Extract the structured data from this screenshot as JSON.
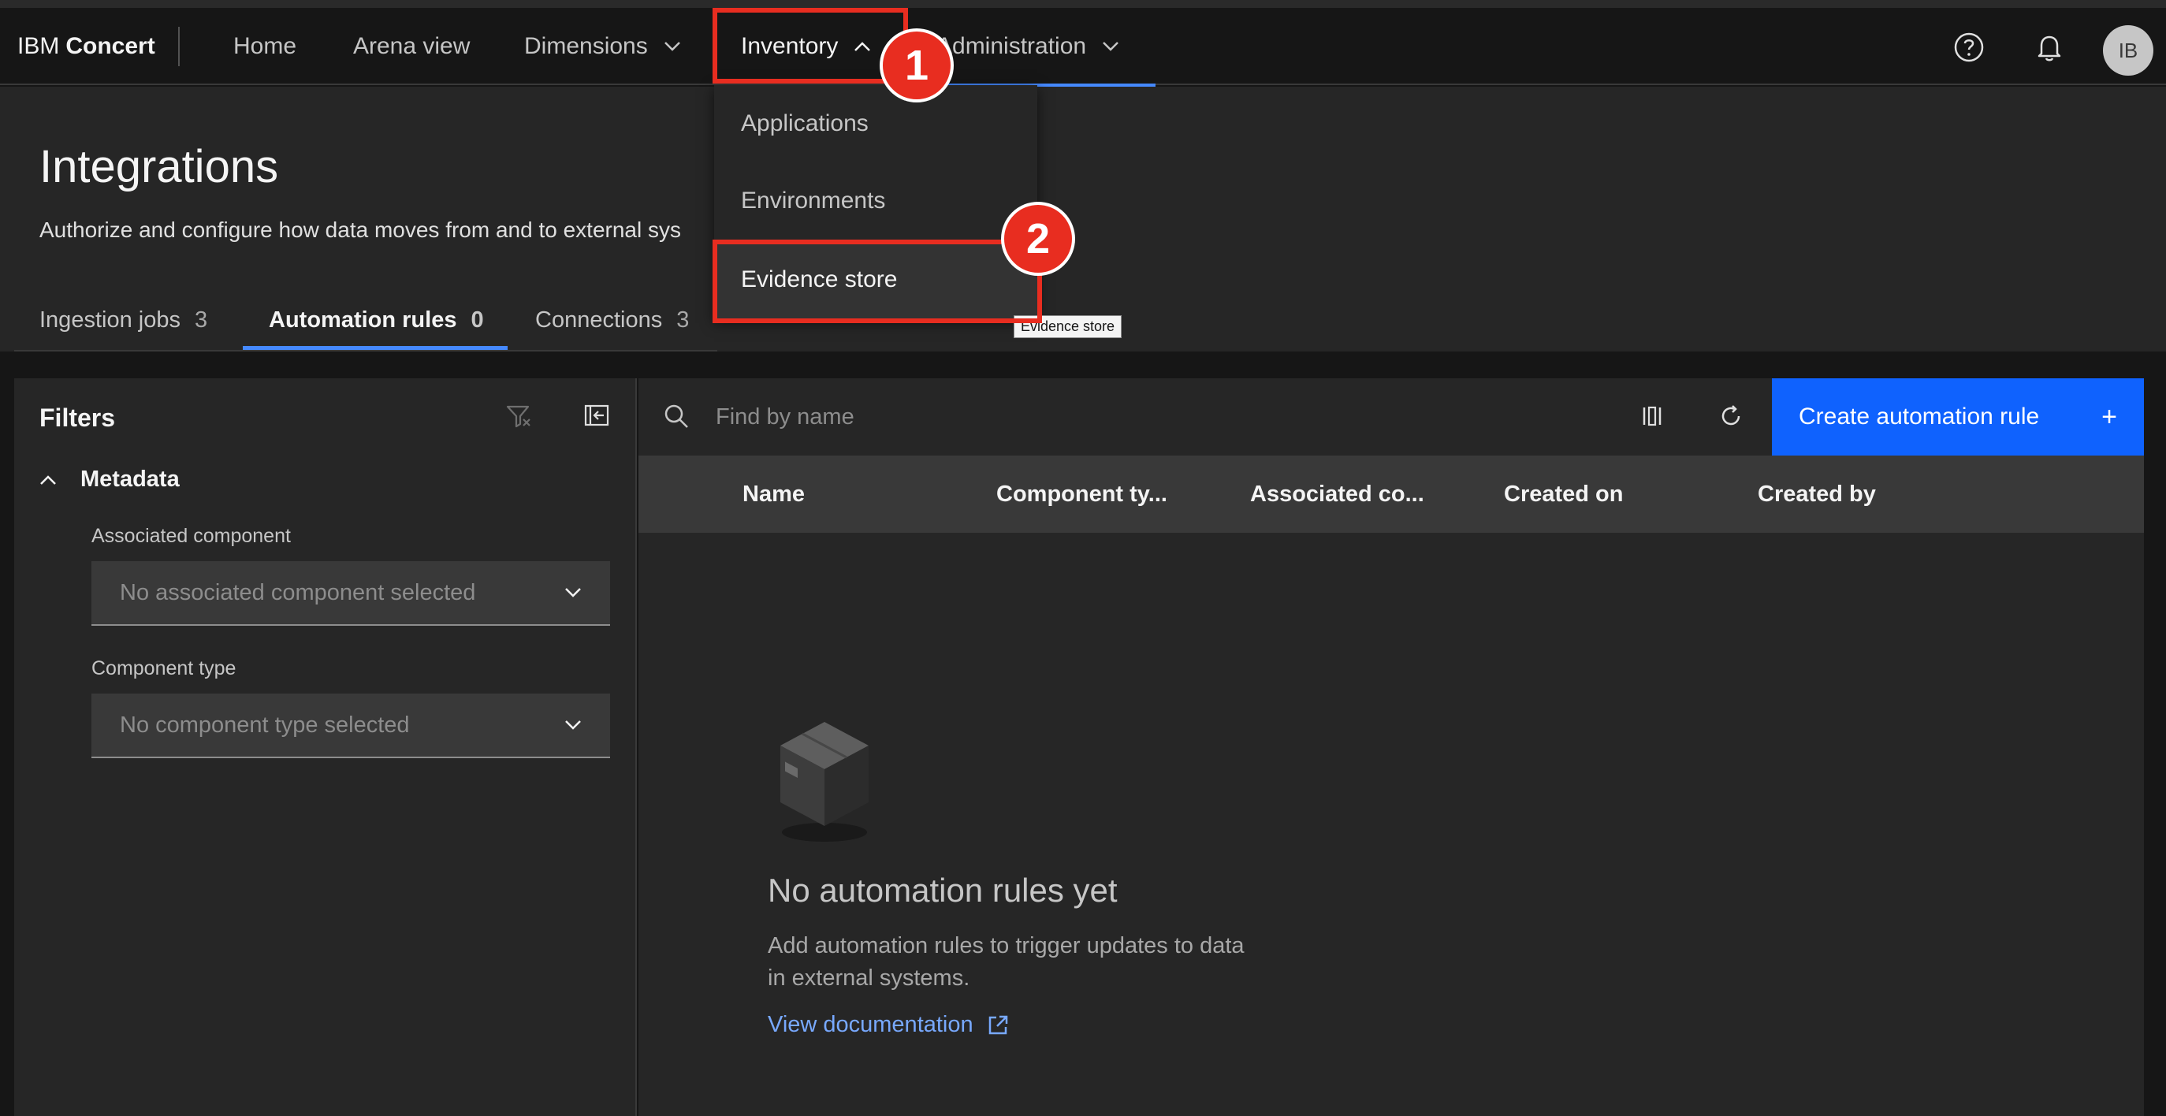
{
  "header": {
    "brand_prefix": "IBM",
    "brand_name": "Concert",
    "nav": {
      "home": "Home",
      "arena": "Arena view",
      "dimensions": "Dimensions",
      "inventory": "Inventory",
      "administration": "Administration"
    },
    "avatar_initials": "IB"
  },
  "inventory_menu": {
    "items": [
      "Applications",
      "Environments",
      "Evidence store"
    ],
    "tooltip": "Evidence store"
  },
  "page": {
    "title": "Integrations",
    "description": "Authorize and configure how data moves from and to external sys"
  },
  "tabs": [
    {
      "label": "Ingestion jobs",
      "count": "3"
    },
    {
      "label": "Automation rules",
      "count": "0"
    },
    {
      "label": "Connections",
      "count": "3"
    }
  ],
  "filters": {
    "title": "Filters",
    "section": "Metadata",
    "associated_label": "Associated component",
    "associated_placeholder": "No associated component selected",
    "type_label": "Component type",
    "type_placeholder": "No component type selected"
  },
  "toolbar": {
    "search_placeholder": "Find by name",
    "create_label": "Create automation rule",
    "create_plus": "+"
  },
  "table": {
    "columns": [
      "Name",
      "Component ty...",
      "Associated co...",
      "Created on",
      "Created by"
    ]
  },
  "empty_state": {
    "title": "No automation rules yet",
    "description": "Add automation rules to trigger updates to data in external systems.",
    "link": "View documentation"
  },
  "annotations": {
    "marker_1": "1",
    "marker_2": "2"
  },
  "colors": {
    "accent": "#0f62fe",
    "highlight": "#e82d20",
    "link": "#78a9ff"
  }
}
